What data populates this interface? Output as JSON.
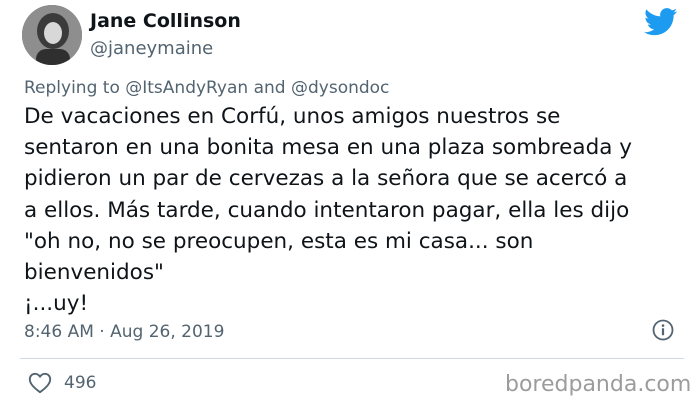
{
  "author": {
    "name": "Jane Collinson",
    "handle": "@janeymaine"
  },
  "reply_to": {
    "prefix": "Replying to",
    "user1": "@ItsAndyRyan",
    "joiner": "and",
    "user2": "@dysondoc"
  },
  "tweet": {
    "text": "De vacaciones en Corfú, unos amigos nuestros se\nsentaron en una bonita mesa en una plaza sombreada y\npidieron un par de cervezas a la señora que se acercó a\na ellos. Más tarde, cuando intentaron pagar, ella les dijo\n\"oh no, no se preocupen, esta es mi casa... son\nbienvenidos\"\n¡...uy!",
    "time": "8:46 AM",
    "separator": "·",
    "date": "Aug 26, 2019"
  },
  "stats": {
    "likes": "496"
  },
  "watermark": "boredpanda.com",
  "icons": {
    "brand": "twitter-bird-icon",
    "info": "info-icon",
    "like": "heart-icon"
  },
  "colors": {
    "twitter_blue": "#1d9bf0",
    "secondary_text": "#536471",
    "primary_text": "#0f1419"
  }
}
